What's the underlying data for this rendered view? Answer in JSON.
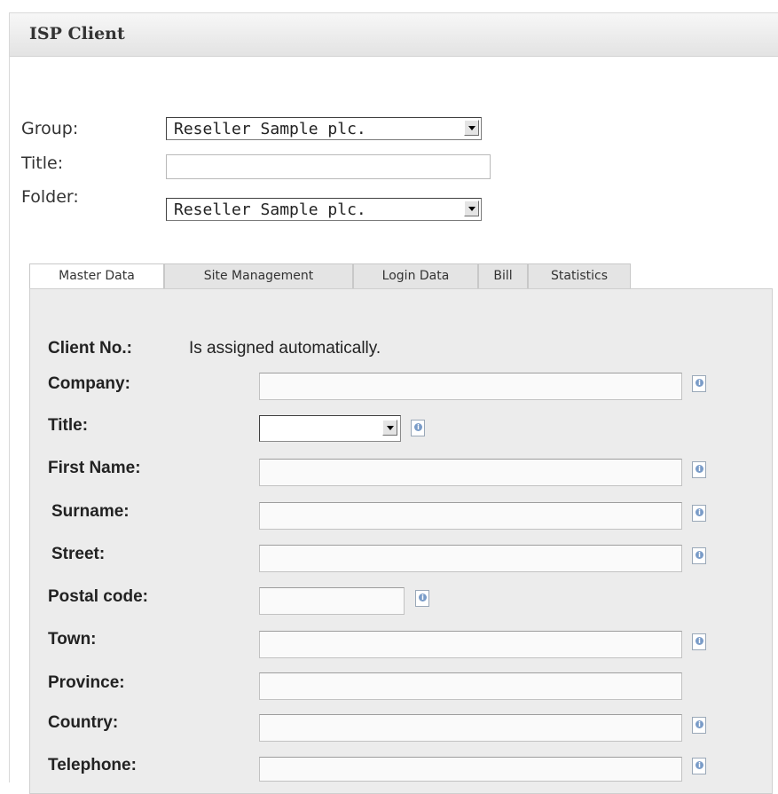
{
  "window": {
    "title": "ISP Client"
  },
  "header_form": {
    "group": {
      "label": "Group:",
      "value": "Reseller Sample plc."
    },
    "title": {
      "label": "Title:",
      "value": ""
    },
    "folder": {
      "label": "Folder:",
      "value": "Reseller Sample plc."
    }
  },
  "tabs": [
    "Master Data",
    "Site Management",
    "Login Data",
    "Bill",
    "Statistics"
  ],
  "master_data": {
    "client_no": {
      "label": "Client No.:",
      "value": "Is assigned automatically."
    },
    "company": {
      "label": "Company:",
      "value": ""
    },
    "title": {
      "label": "Title:",
      "value": ""
    },
    "first_name": {
      "label": "First Name:",
      "value": ""
    },
    "surname": {
      "label": "Surname:",
      "value": ""
    },
    "street": {
      "label": "Street:",
      "value": ""
    },
    "postal_code": {
      "label": "Postal code:",
      "value": ""
    },
    "town": {
      "label": "Town:",
      "value": ""
    },
    "province": {
      "label": "Province:",
      "value": ""
    },
    "country": {
      "label": "Country:",
      "value": ""
    },
    "telephone": {
      "label": "Telephone:",
      "value": ""
    }
  },
  "icons": {
    "info": "info-icon",
    "dropdown": "chevron-down-icon"
  }
}
